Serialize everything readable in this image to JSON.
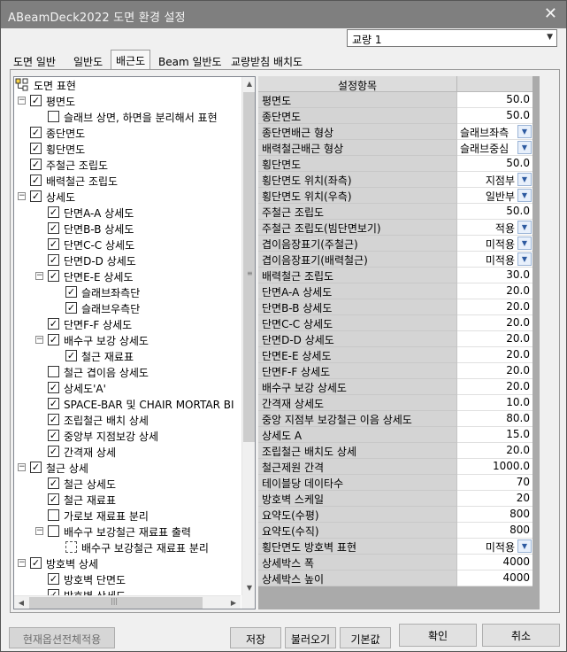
{
  "window": {
    "title": "ABeamDeck2022 도면 환경 설정",
    "close": "✕"
  },
  "bridge_combo": {
    "value": "교량 1"
  },
  "tabs": [
    {
      "label": "도면 일반",
      "active": false
    },
    {
      "label": "일반도",
      "active": false
    },
    {
      "label": "배근도",
      "active": true
    },
    {
      "label": "Beam 일반도",
      "active": false
    },
    {
      "label": "교량받침 배치도",
      "active": false
    }
  ],
  "tree": {
    "root": "도면 표현",
    "rows": [
      {
        "label": "평면도",
        "level": 1,
        "toggle": "-",
        "checked": true
      },
      {
        "label": "슬래브 상면, 하면을 분리해서 표현",
        "level": 2,
        "checked": false
      },
      {
        "label": "종단면도",
        "level": 1,
        "checked": true
      },
      {
        "label": "횡단면도",
        "level": 1,
        "checked": true
      },
      {
        "label": "주철근 조립도",
        "level": 1,
        "checked": true
      },
      {
        "label": "배력철근 조립도",
        "level": 1,
        "checked": true
      },
      {
        "label": "상세도",
        "level": 1,
        "toggle": "-",
        "checked": true
      },
      {
        "label": "단면A-A 상세도",
        "level": 2,
        "checked": true
      },
      {
        "label": "단면B-B 상세도",
        "level": 2,
        "checked": true
      },
      {
        "label": "단면C-C 상세도",
        "level": 2,
        "checked": true
      },
      {
        "label": "단면D-D 상세도",
        "level": 2,
        "checked": true
      },
      {
        "label": "단면E-E 상세도",
        "level": 2,
        "toggle": "-",
        "checked": true
      },
      {
        "label": "슬래브좌측단",
        "level": 3,
        "checked": true
      },
      {
        "label": "슬래브우측단",
        "level": 3,
        "checked": true
      },
      {
        "label": "단면F-F 상세도",
        "level": 2,
        "checked": true
      },
      {
        "label": "배수구 보강 상세도",
        "level": 2,
        "toggle": "-",
        "checked": true
      },
      {
        "label": "철근 재료표",
        "level": 3,
        "checked": true
      },
      {
        "label": "철근 겹이음 상세도",
        "level": 2,
        "checked": false
      },
      {
        "label": "상세도'A'",
        "level": 2,
        "checked": true
      },
      {
        "label": "SPACE-BAR 및 CHAIR MORTAR BI",
        "level": 2,
        "checked": true
      },
      {
        "label": "조립철근 배치 상세",
        "level": 2,
        "checked": true
      },
      {
        "label": "중앙부 지점보강 상세",
        "level": 2,
        "checked": true
      },
      {
        "label": "간격재 상세",
        "level": 2,
        "checked": true
      },
      {
        "label": "철근 상세",
        "level": 1,
        "toggle": "-",
        "checked": true
      },
      {
        "label": "철근 상세도",
        "level": 2,
        "checked": true
      },
      {
        "label": "철근 재료표",
        "level": 2,
        "checked": true
      },
      {
        "label": "가로보 재료표 분리",
        "level": 2,
        "checked": false
      },
      {
        "label": "배수구 보강철근 재료표 출력",
        "level": 2,
        "toggle": "-",
        "checked": false
      },
      {
        "label": "배수구 보강철근 재료표 분리",
        "level": 3,
        "checked": false,
        "dashed": true
      },
      {
        "label": "방호벽 상세",
        "level": 1,
        "toggle": "-",
        "checked": true
      },
      {
        "label": "방호벽 단면도",
        "level": 2,
        "checked": true
      },
      {
        "label": "방호벽 상세도",
        "level": 2,
        "checked": true
      }
    ],
    "scroll_up": "▲",
    "scroll_down": "▼",
    "scroll_left": "◀",
    "scroll_right": "▶",
    "grip_v": "≡",
    "grip_h": "|||"
  },
  "grid": {
    "header": "설정항목",
    "rows": [
      {
        "name": "평면도",
        "value": "50.0"
      },
      {
        "name": "종단면도",
        "value": "50.0"
      },
      {
        "name": "종단면배근 형상",
        "value": "슬래브좌측",
        "combo": true
      },
      {
        "name": "배력철근배근 형상",
        "value": "슬래브중심",
        "combo": true
      },
      {
        "name": "횡단면도",
        "value": "50.0"
      },
      {
        "name": "횡단면도 위치(좌측)",
        "value": "지점부",
        "combo": true
      },
      {
        "name": "횡단면도 위치(우측)",
        "value": "일반부",
        "combo": true
      },
      {
        "name": "주철근 조립도",
        "value": "50.0"
      },
      {
        "name": "주철근 조립도(빔단면보기)",
        "value": "적용",
        "combo": true
      },
      {
        "name": "겹이음장표기(주철근)",
        "value": "미적용",
        "combo": true
      },
      {
        "name": "겹이음장표기(배력철근)",
        "value": "미적용",
        "combo": true
      },
      {
        "name": "배력철근 조립도",
        "value": "30.0"
      },
      {
        "name": "단면A-A 상세도",
        "value": "20.0"
      },
      {
        "name": "단면B-B 상세도",
        "value": "20.0"
      },
      {
        "name": "단면C-C 상세도",
        "value": "20.0"
      },
      {
        "name": "단면D-D 상세도",
        "value": "20.0"
      },
      {
        "name": "단면E-E 상세도",
        "value": "20.0"
      },
      {
        "name": "단면F-F 상세도",
        "value": "20.0"
      },
      {
        "name": "배수구 보강 상세도",
        "value": "20.0"
      },
      {
        "name": "간격재 상세도",
        "value": "10.0"
      },
      {
        "name": "중앙 지점부 보강철근 이음 상세도",
        "value": "80.0"
      },
      {
        "name": "상세도 A",
        "value": "15.0"
      },
      {
        "name": "조립철근 배치도 상세",
        "value": "20.0"
      },
      {
        "name": "철근제원 간격",
        "value": "1000.0"
      },
      {
        "name": "테이블당 데이타수",
        "value": "70"
      },
      {
        "name": "방호벽 스케일",
        "value": "20"
      },
      {
        "name": "요약도(수평)",
        "value": "800"
      },
      {
        "name": "요약도(수직)",
        "value": "800"
      },
      {
        "name": "횡단면도 방호벽 표현",
        "value": "미적용",
        "combo": true
      },
      {
        "name": "상세박스 폭",
        "value": "4000"
      },
      {
        "name": "상세박스 높이",
        "value": "4000"
      }
    ]
  },
  "buttons": {
    "apply_all": "현재옵션전체적용",
    "save": "저장",
    "load": "불러오기",
    "default": "기본값",
    "ok": "확인",
    "cancel": "취소"
  },
  "colors": {
    "titlebar": "#7f7f7f",
    "grid_name_bg": "#d4d4d4",
    "dropdown_accent": "#2d5aa0"
  }
}
